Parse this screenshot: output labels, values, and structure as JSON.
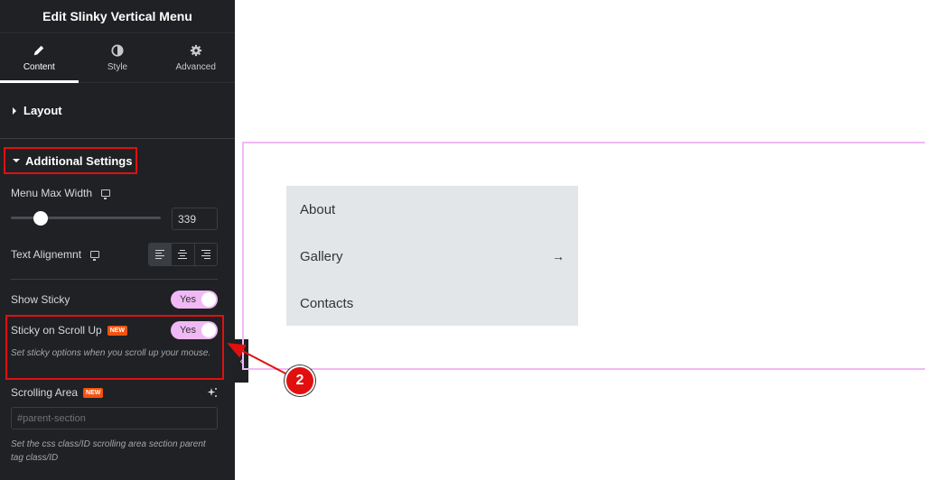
{
  "panel": {
    "title": "Edit Slinky Vertical Menu",
    "tabs": [
      {
        "label": "Content",
        "icon": "pencil-icon",
        "active": true
      },
      {
        "label": "Style",
        "icon": "contrast-icon",
        "active": false
      },
      {
        "label": "Advanced",
        "icon": "gear-icon",
        "active": false
      }
    ],
    "sections": {
      "layout": "Layout",
      "additional": "Additional Settings"
    },
    "controls": {
      "menu_max_width": {
        "label": "Menu Max Width",
        "value": "339",
        "slider_fraction": 0.2
      },
      "text_alignment": {
        "label": "Text Alignemnt",
        "options": [
          "left",
          "center",
          "right"
        ],
        "selected": "left"
      },
      "show_sticky": {
        "label": "Show Sticky",
        "value": "Yes"
      },
      "sticky_on_scroll_up": {
        "label": "Sticky on Scroll Up",
        "badge": "NEW",
        "value": "Yes",
        "help": "Set sticky options when you scroll up your mouse."
      },
      "scrolling_area": {
        "label": "Scrolling Area",
        "badge": "NEW",
        "placeholder": "#parent-section",
        "help": "Set the css class/ID scrolling area section parent tag class/ID"
      }
    }
  },
  "canvas": {
    "menu_items": [
      {
        "label": "About",
        "has_arrow": false
      },
      {
        "label": "Gallery",
        "has_arrow": true,
        "arrow": "→"
      },
      {
        "label": "Contacts",
        "has_arrow": false
      }
    ]
  },
  "annotation": {
    "step": "2"
  },
  "colors": {
    "accent_toggle": "#f0b9f5",
    "highlight": "#e20f0f",
    "badge": "#f5520e",
    "panel_bg": "#1f2124"
  }
}
